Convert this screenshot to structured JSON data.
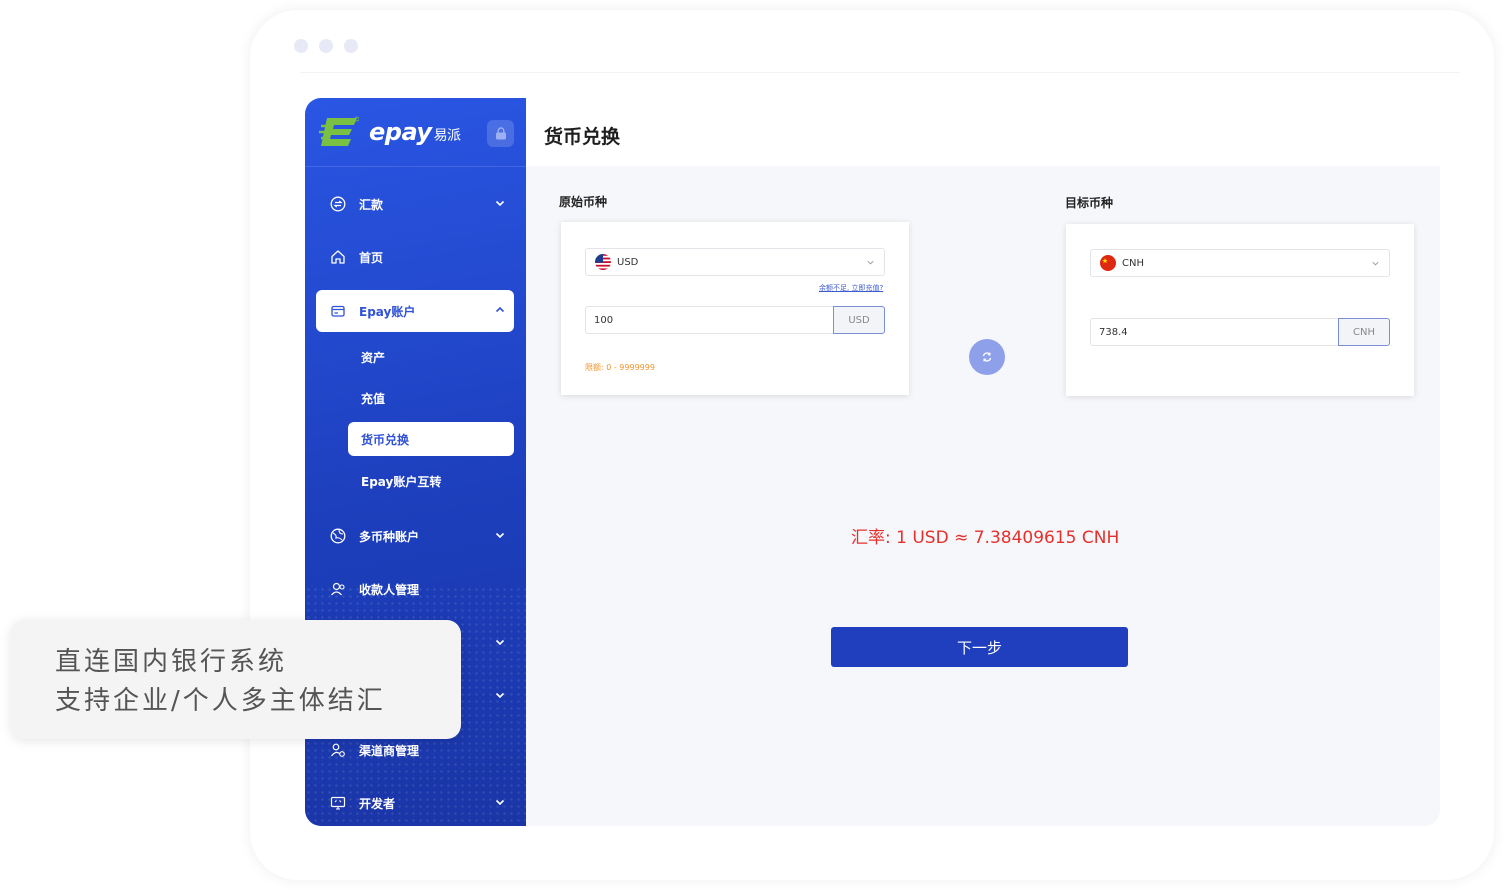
{
  "brand": {
    "logo_text": "epay",
    "logo_cn": "易派"
  },
  "sidebar": {
    "items": [
      {
        "label": "汇款",
        "icon": "transfer-icon",
        "expandable": true
      },
      {
        "label": "首页",
        "icon": "home-icon",
        "expandable": false
      },
      {
        "label": "Epay账户",
        "icon": "wallet-icon",
        "expandable": true,
        "active": true
      },
      {
        "label": "多币种账户",
        "icon": "globe-icon",
        "expandable": true
      },
      {
        "label": "收款人管理",
        "icon": "payee-icon",
        "expandable": false
      },
      {
        "label": "渠道商管理",
        "icon": "channel-icon",
        "expandable": false
      },
      {
        "label": "开发者",
        "icon": "developer-icon",
        "expandable": true
      }
    ],
    "subitems": [
      {
        "label": "资产"
      },
      {
        "label": "充值"
      },
      {
        "label": "货币兑换",
        "active": true
      },
      {
        "label": "Epay账户互转"
      }
    ]
  },
  "page": {
    "title": "货币兑换"
  },
  "source": {
    "label": "原始币种",
    "currency": "USD",
    "amount": "100",
    "unit": "USD",
    "balance_link": "余额不足, 立即充值?",
    "limit": "限额: 0 - 9999999"
  },
  "target": {
    "label": "目标币种",
    "currency": "CNH",
    "amount": "738.4",
    "unit": "CNH"
  },
  "rate_text": "汇率: 1 USD ≈ 7.38409615 CNH",
  "next_button": "下一步",
  "callout": {
    "line1": "直连国内银行系统",
    "line2": "支持企业/个人多主体结汇"
  },
  "colors": {
    "sidebar_blue": "#2448d0",
    "primary_button": "#1f3fbe",
    "rate_red": "#e5312d",
    "limit_orange": "#f0952f",
    "swap_button": "#8fa0ea"
  }
}
